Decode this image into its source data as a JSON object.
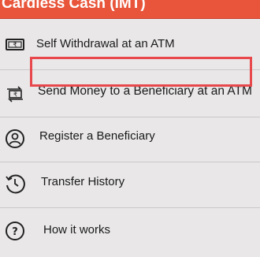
{
  "header": {
    "title": "Cardless Cash (IMT)"
  },
  "menu": {
    "items": [
      {
        "label": "Self Withdrawal at an ATM",
        "icon": "cash-note-icon"
      },
      {
        "label": "Send Money to a Beneficiary at an ATM",
        "icon": "rupee-transfer-icon",
        "highlighted": true
      },
      {
        "label": "Register a Beneficiary",
        "icon": "user-circle-icon"
      },
      {
        "label": "Transfer History",
        "icon": "history-clock-icon"
      },
      {
        "label": "How it works",
        "icon": "help-circle-icon"
      }
    ]
  },
  "colors": {
    "header_bg": "#e8553a",
    "highlight_border": "#e8474c",
    "background": "#e9e7e8"
  }
}
